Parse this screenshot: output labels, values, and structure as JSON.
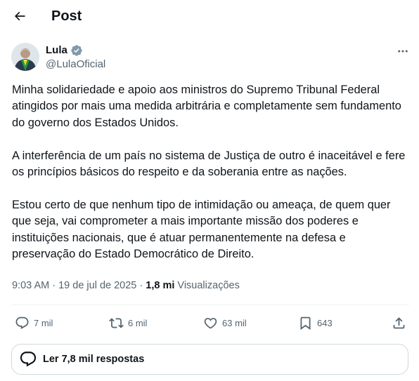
{
  "header": {
    "title": "Post",
    "back_icon": "arrow-left-icon"
  },
  "author": {
    "name": "Lula",
    "handle": "@LulaOficial",
    "verified": true,
    "verified_color": "#829aab"
  },
  "tweet": {
    "paragraphs": [
      "Minha solidariedade e apoio aos ministros do Supremo Tribunal Federal atingidos por mais uma medida arbitrária e completamente sem fundamento do governo dos Estados Unidos.",
      "A interferência de um país no sistema de Justiça de outro é inaceitável e fere os princípios básicos do respeito e da soberania entre as nações.",
      "Estou certo de que nenhum tipo de intimidação ou ameaça, de quem quer que seja, vai comprometer a mais importante missão dos poderes e instituições nacionais, que é atuar permanentemente na defesa e preservação do Estado Democrático de Direito."
    ]
  },
  "meta": {
    "time": "9:03 AM",
    "separator": "·",
    "date": "19 de jul de 2025",
    "views_count": "1,8 mi",
    "views_label": "Visualizações"
  },
  "actions": {
    "replies": {
      "icon": "reply-icon",
      "count": "7 mil"
    },
    "reposts": {
      "icon": "repost-icon",
      "count": "6 mil"
    },
    "likes": {
      "icon": "heart-icon",
      "count": "63 mil"
    },
    "bookmarks": {
      "icon": "bookmark-icon",
      "count": "643"
    },
    "share": {
      "icon": "share-icon"
    }
  },
  "replies_pill": {
    "label": "Ler 7,8 mil respostas",
    "icon": "speech-bubble-icon"
  },
  "colors": {
    "text": "#0f1419",
    "secondary": "#536471",
    "divider": "#eff3f4",
    "border": "#cfd9de"
  }
}
